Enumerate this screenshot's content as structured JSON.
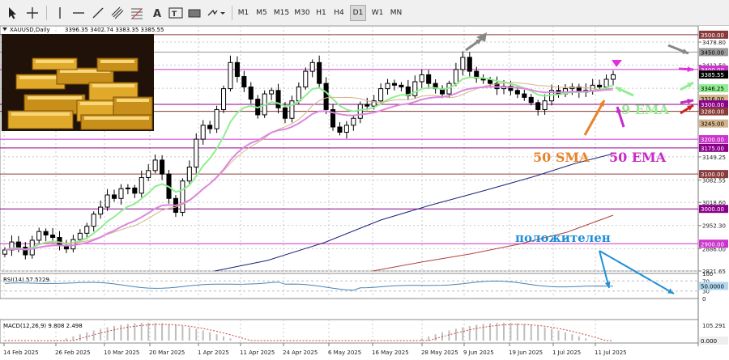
{
  "toolbar": {
    "timeframes": [
      "M1",
      "M5",
      "M15",
      "M30",
      "H1",
      "H4",
      "D1",
      "W1",
      "MN"
    ],
    "active_timeframe": "D1"
  },
  "chart_header": {
    "symbol": "XAUUSD,Daily",
    "ohlc": "3396.35 3402.74 3383.35 3385.55"
  },
  "annotations": {
    "sma50": "50 SMA",
    "ema50": "50 EMA",
    "ema9": "9 EMA",
    "positive": "положителен"
  },
  "colors": {
    "grid": "#c8c8c8",
    "candle": "#000000",
    "ema9": "#90ee90",
    "sma50": "#d2b48c",
    "ema50": "#dd88dd",
    "sma100": "#1a237e",
    "sma200": "#b04040",
    "rsi": "#4682b4",
    "level_magenta": "#8b008b",
    "level_brown": "#8b3a3a",
    "label_orange": "#e8822a",
    "label_magenta": "#c72bc7",
    "label_green": "#90ee90",
    "label_blue": "#1f8fd8"
  },
  "price_axis": {
    "labels": [
      "3478.80",
      "3412.50",
      "3346.25",
      "3280.00",
      "3149.25",
      "3082.55",
      "3018.60",
      "2952.30",
      "2886.00",
      "2821.65"
    ],
    "levels": [
      {
        "label": "3500.00",
        "price": 3500,
        "color": "#8b3a3a"
      },
      {
        "label": "3450.00",
        "price": 3450,
        "color": "#999999"
      },
      {
        "label": "3400.00",
        "price": 3400,
        "color": "#cc33cc"
      },
      {
        "label": "3385.55",
        "price": 3385.55,
        "color": "#000000"
      },
      {
        "label": "3346.25",
        "price": 3346.25,
        "color": "#90ee90"
      },
      {
        "label": "3316.00",
        "price": 3316,
        "color": "#d2b48c"
      },
      {
        "label": "3300.00",
        "price": 3300,
        "color": "#8b008b"
      },
      {
        "label": "3280.00",
        "price": 3280,
        "color": "#8b3a3a"
      },
      {
        "label": "3245.00",
        "price": 3245,
        "color": "#d2b48c"
      },
      {
        "label": "3200.00",
        "price": 3200,
        "color": "#cc33cc"
      },
      {
        "label": "3175.00",
        "price": 3175,
        "color": "#8b008b"
      },
      {
        "label": "3100.00",
        "price": 3100,
        "color": "#8b3a3a"
      },
      {
        "label": "3000.00",
        "price": 3000,
        "color": "#8b008b"
      },
      {
        "label": "2900.00",
        "price": 2900,
        "color": "#cc33cc"
      }
    ]
  },
  "rsi": {
    "label": "RSI(14) 57.5229",
    "axis_labels": [
      "100",
      "70",
      "30",
      "0"
    ],
    "current": "50.0000"
  },
  "macd": {
    "label": "MACD(12,26,9) 9.808 2.498",
    "axis_labels": [
      "105.291",
      "0.000"
    ]
  },
  "chart_data": {
    "type": "candlestick",
    "title": "XAUUSD,Daily",
    "dates": [
      "14 Feb 2025",
      "26 Feb 2025",
      "10 Mar 2025",
      "20 Mar 2025",
      "1 Apr 2025",
      "11 Apr 2025",
      "24 Apr 2025",
      "6 May 2025",
      "16 May 2025",
      "28 May 2025",
      "9 Jun 2025",
      "19 Jun 2025",
      "1 Jul 2025",
      "11 Jul 2025"
    ],
    "close": [
      2882,
      2905,
      2890,
      2868,
      2910,
      2935,
      2925,
      2918,
      2895,
      2885,
      2912,
      2930,
      2950,
      2985,
      3005,
      3040,
      3030,
      3058,
      3060,
      3045,
      3090,
      3110,
      3140,
      3100,
      3030,
      2990,
      3080,
      3120,
      3200,
      3240,
      3230,
      3285,
      3345,
      3420,
      3380,
      3350,
      3315,
      3270,
      3330,
      3340,
      3290,
      3260,
      3310,
      3350,
      3395,
      3420,
      3360,
      3285,
      3235,
      3220,
      3240,
      3260,
      3300,
      3295,
      3310,
      3345,
      3360,
      3355,
      3350,
      3325,
      3365,
      3385,
      3360,
      3345,
      3330,
      3360,
      3400,
      3435,
      3395,
      3375,
      3370,
      3360,
      3345,
      3352,
      3340,
      3330,
      3320,
      3305,
      3285,
      3310,
      3340,
      3330,
      3345,
      3350,
      3335,
      3340,
      3355,
      3350,
      3372,
      3385
    ]
  }
}
